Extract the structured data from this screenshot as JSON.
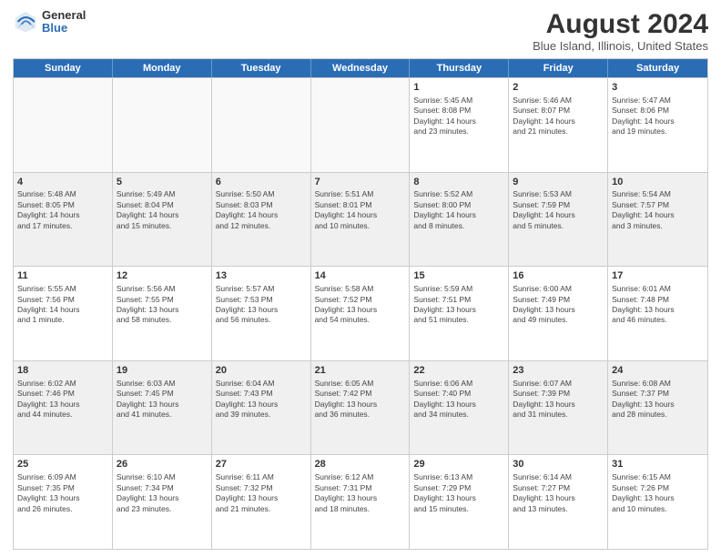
{
  "logo": {
    "general": "General",
    "blue": "Blue"
  },
  "title": "August 2024",
  "subtitle": "Blue Island, Illinois, United States",
  "days_of_week": [
    "Sunday",
    "Monday",
    "Tuesday",
    "Wednesday",
    "Thursday",
    "Friday",
    "Saturday"
  ],
  "weeks": [
    [
      {
        "day": "",
        "content": "",
        "empty": true
      },
      {
        "day": "",
        "content": "",
        "empty": true
      },
      {
        "day": "",
        "content": "",
        "empty": true
      },
      {
        "day": "",
        "content": "",
        "empty": true
      },
      {
        "day": "1",
        "content": "Sunrise: 5:45 AM\nSunset: 8:08 PM\nDaylight: 14 hours\nand 23 minutes.",
        "empty": false
      },
      {
        "day": "2",
        "content": "Sunrise: 5:46 AM\nSunset: 8:07 PM\nDaylight: 14 hours\nand 21 minutes.",
        "empty": false
      },
      {
        "day": "3",
        "content": "Sunrise: 5:47 AM\nSunset: 8:06 PM\nDaylight: 14 hours\nand 19 minutes.",
        "empty": false
      }
    ],
    [
      {
        "day": "4",
        "content": "Sunrise: 5:48 AM\nSunset: 8:05 PM\nDaylight: 14 hours\nand 17 minutes.",
        "empty": false
      },
      {
        "day": "5",
        "content": "Sunrise: 5:49 AM\nSunset: 8:04 PM\nDaylight: 14 hours\nand 15 minutes.",
        "empty": false
      },
      {
        "day": "6",
        "content": "Sunrise: 5:50 AM\nSunset: 8:03 PM\nDaylight: 14 hours\nand 12 minutes.",
        "empty": false
      },
      {
        "day": "7",
        "content": "Sunrise: 5:51 AM\nSunset: 8:01 PM\nDaylight: 14 hours\nand 10 minutes.",
        "empty": false
      },
      {
        "day": "8",
        "content": "Sunrise: 5:52 AM\nSunset: 8:00 PM\nDaylight: 14 hours\nand 8 minutes.",
        "empty": false
      },
      {
        "day": "9",
        "content": "Sunrise: 5:53 AM\nSunset: 7:59 PM\nDaylight: 14 hours\nand 5 minutes.",
        "empty": false
      },
      {
        "day": "10",
        "content": "Sunrise: 5:54 AM\nSunset: 7:57 PM\nDaylight: 14 hours\nand 3 minutes.",
        "empty": false
      }
    ],
    [
      {
        "day": "11",
        "content": "Sunrise: 5:55 AM\nSunset: 7:56 PM\nDaylight: 14 hours\nand 1 minute.",
        "empty": false
      },
      {
        "day": "12",
        "content": "Sunrise: 5:56 AM\nSunset: 7:55 PM\nDaylight: 13 hours\nand 58 minutes.",
        "empty": false
      },
      {
        "day": "13",
        "content": "Sunrise: 5:57 AM\nSunset: 7:53 PM\nDaylight: 13 hours\nand 56 minutes.",
        "empty": false
      },
      {
        "day": "14",
        "content": "Sunrise: 5:58 AM\nSunset: 7:52 PM\nDaylight: 13 hours\nand 54 minutes.",
        "empty": false
      },
      {
        "day": "15",
        "content": "Sunrise: 5:59 AM\nSunset: 7:51 PM\nDaylight: 13 hours\nand 51 minutes.",
        "empty": false
      },
      {
        "day": "16",
        "content": "Sunrise: 6:00 AM\nSunset: 7:49 PM\nDaylight: 13 hours\nand 49 minutes.",
        "empty": false
      },
      {
        "day": "17",
        "content": "Sunrise: 6:01 AM\nSunset: 7:48 PM\nDaylight: 13 hours\nand 46 minutes.",
        "empty": false
      }
    ],
    [
      {
        "day": "18",
        "content": "Sunrise: 6:02 AM\nSunset: 7:46 PM\nDaylight: 13 hours\nand 44 minutes.",
        "empty": false
      },
      {
        "day": "19",
        "content": "Sunrise: 6:03 AM\nSunset: 7:45 PM\nDaylight: 13 hours\nand 41 minutes.",
        "empty": false
      },
      {
        "day": "20",
        "content": "Sunrise: 6:04 AM\nSunset: 7:43 PM\nDaylight: 13 hours\nand 39 minutes.",
        "empty": false
      },
      {
        "day": "21",
        "content": "Sunrise: 6:05 AM\nSunset: 7:42 PM\nDaylight: 13 hours\nand 36 minutes.",
        "empty": false
      },
      {
        "day": "22",
        "content": "Sunrise: 6:06 AM\nSunset: 7:40 PM\nDaylight: 13 hours\nand 34 minutes.",
        "empty": false
      },
      {
        "day": "23",
        "content": "Sunrise: 6:07 AM\nSunset: 7:39 PM\nDaylight: 13 hours\nand 31 minutes.",
        "empty": false
      },
      {
        "day": "24",
        "content": "Sunrise: 6:08 AM\nSunset: 7:37 PM\nDaylight: 13 hours\nand 28 minutes.",
        "empty": false
      }
    ],
    [
      {
        "day": "25",
        "content": "Sunrise: 6:09 AM\nSunset: 7:35 PM\nDaylight: 13 hours\nand 26 minutes.",
        "empty": false
      },
      {
        "day": "26",
        "content": "Sunrise: 6:10 AM\nSunset: 7:34 PM\nDaylight: 13 hours\nand 23 minutes.",
        "empty": false
      },
      {
        "day": "27",
        "content": "Sunrise: 6:11 AM\nSunset: 7:32 PM\nDaylight: 13 hours\nand 21 minutes.",
        "empty": false
      },
      {
        "day": "28",
        "content": "Sunrise: 6:12 AM\nSunset: 7:31 PM\nDaylight: 13 hours\nand 18 minutes.",
        "empty": false
      },
      {
        "day": "29",
        "content": "Sunrise: 6:13 AM\nSunset: 7:29 PM\nDaylight: 13 hours\nand 15 minutes.",
        "empty": false
      },
      {
        "day": "30",
        "content": "Sunrise: 6:14 AM\nSunset: 7:27 PM\nDaylight: 13 hours\nand 13 minutes.",
        "empty": false
      },
      {
        "day": "31",
        "content": "Sunrise: 6:15 AM\nSunset: 7:26 PM\nDaylight: 13 hours\nand 10 minutes.",
        "empty": false
      }
    ]
  ]
}
